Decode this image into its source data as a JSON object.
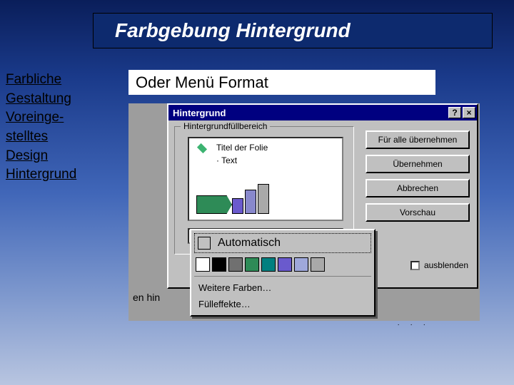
{
  "header": {
    "title": "Farbgebung Hintergrund"
  },
  "sidebar": {
    "items": [
      {
        "label": "Farbliche"
      },
      {
        "label": "Gestaltung"
      },
      {
        "label": "Voreinge-"
      },
      {
        "label": "stelltes"
      },
      {
        "label": "Design"
      },
      {
        "label": "Hintergrund"
      }
    ]
  },
  "subtitle": "Oder Menü Format",
  "dialog": {
    "title": "Hintergrund",
    "help_label": "?",
    "close_label": "×",
    "groupbox_label": "Hintergrundfüllbereich",
    "slide_title": "Titel der Folie",
    "slide_bullet": "· Text",
    "buttons": {
      "apply_all": "Für alle übernehmen",
      "apply": "Übernehmen",
      "cancel": "Abbrechen",
      "preview": "Vorschau"
    },
    "checkbox_label": "ausblenden"
  },
  "color_popup": {
    "automatic": "Automatisch",
    "swatches": [
      "#ffffff",
      "#000000",
      "#707070",
      "#2e8b57",
      "#008080",
      "#6a5acd",
      "#9fa8da",
      "#a9a9a9"
    ],
    "more_colors": "Weitere Farben…",
    "fill_effects": "Fülleffekte…"
  },
  "hint": "en hin"
}
